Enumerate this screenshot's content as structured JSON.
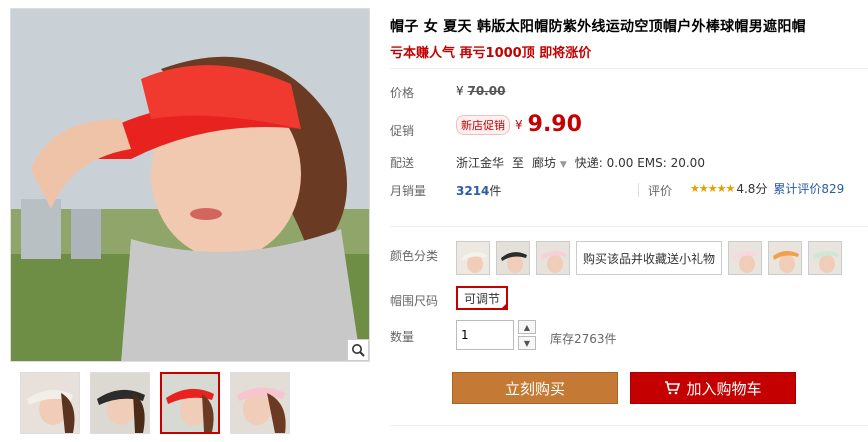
{
  "product": {
    "title": "帽子 女 夏天 韩版太阳帽防紫外线运动空顶帽户外棒球帽男遮阳帽",
    "subtitle": "亏本赚人气 再亏1000顶 即将涨价"
  },
  "price": {
    "label": "价格",
    "currency": "¥",
    "original": "70.00"
  },
  "promo": {
    "label": "促销",
    "badge": "新店促销",
    "currency": "¥",
    "price": "9.90"
  },
  "shipping": {
    "label": "配送",
    "from": "浙江金华",
    "to_word": "至",
    "to": "廊坊",
    "fees": "快递: 0.00 EMS: 20.00"
  },
  "sales": {
    "label": "月销量",
    "count": "3214",
    "unit": "件",
    "rating_label": "评价",
    "stars": "★★★★★",
    "score": "4.8分",
    "reviews": "累计评价829",
    "star_color": "#e3a000"
  },
  "color": {
    "label": "颜色分类",
    "gift_option": "购买该品并收藏送小礼物"
  },
  "size": {
    "label": "帽围尺码",
    "option": "可调节"
  },
  "quantity": {
    "label": "数量",
    "value": "1",
    "stock": "库存2763件"
  },
  "actions": {
    "buy": "立刻购买",
    "cart": "加入购物车"
  },
  "colors": {
    "accent": "#c40000",
    "buy_button": "#c47a35"
  }
}
